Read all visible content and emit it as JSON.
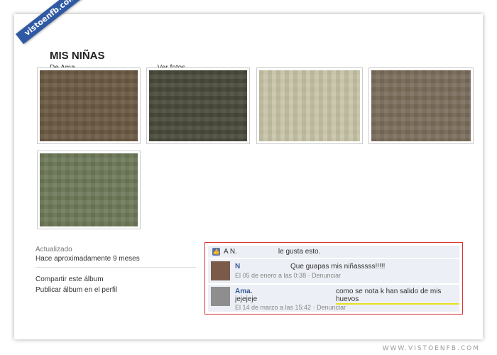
{
  "badge": "vistoenfb.com",
  "album": {
    "title": "MIS NIÑAS",
    "by_prefix": "De Ama",
    "view_photos": "· Ver fotos"
  },
  "photos": [
    {
      "alt": "photo-1"
    },
    {
      "alt": "photo-2"
    },
    {
      "alt": "photo-3"
    },
    {
      "alt": "photo-4"
    },
    {
      "alt": "photo-5"
    }
  ],
  "info": {
    "updated_label": "Actualizado",
    "updated_value": "Hace aproximadamente 9 meses",
    "share_link": "Compartir este álbum",
    "publish_link": "Publicar álbum en el perfil"
  },
  "likes": {
    "prefix": "A N.",
    "suffix": "le gusta esto."
  },
  "comments": [
    {
      "name": "N",
      "text": "Que guapas mis niñasssss!!!!!",
      "date": "El 05 de enero a las 0:38",
      "action": "Denunciar"
    },
    {
      "name": "Ama.",
      "text": "como se nota k han salido de mis huevos",
      "text2": "jejejeje",
      "date": "El 14 de marzo a las 15:42",
      "action": "Denunciar"
    }
  ],
  "watermark": "WWW.VISTOENFB.COM"
}
